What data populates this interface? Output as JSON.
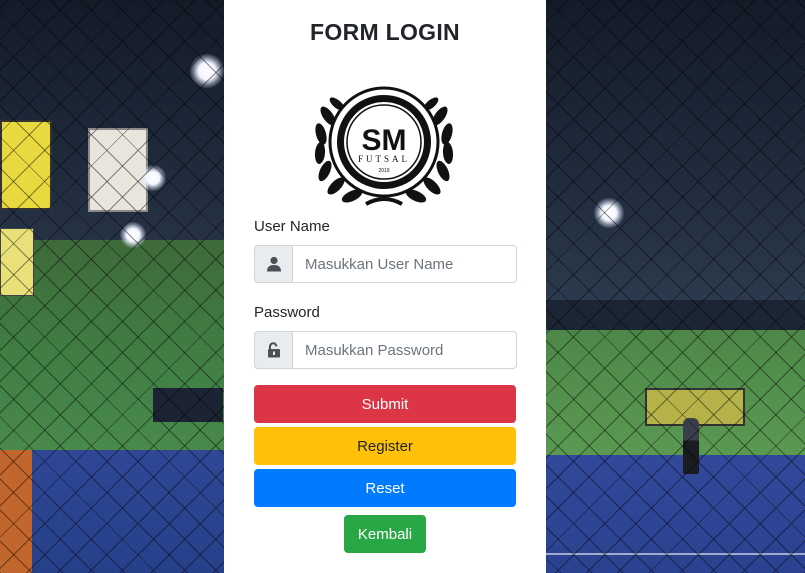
{
  "form": {
    "title": "FORM LOGIN",
    "logo": {
      "top_text": "SINDANGMEKAR FUTSAL",
      "initials": "SM",
      "word": "FUTSAL",
      "year": "2019"
    },
    "username": {
      "label": "User Name",
      "placeholder": "Masukkan User Name",
      "value": "",
      "icon": "user-icon"
    },
    "password": {
      "label": "Password",
      "placeholder": "Masukkan Password",
      "value": "",
      "icon": "unlock-icon"
    },
    "buttons": {
      "submit": "Submit",
      "register": "Register",
      "reset": "Reset",
      "back": "Kembali"
    }
  },
  "colors": {
    "submit": "#dc3545",
    "register": "#ffc107",
    "reset": "#007bff",
    "back": "#28a745"
  }
}
